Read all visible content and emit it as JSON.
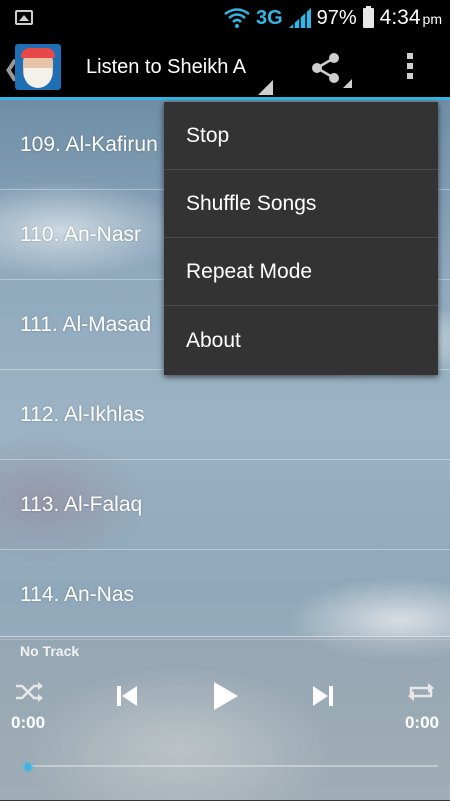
{
  "status_bar": {
    "network_type": "3G",
    "battery_percent": "97%",
    "time": "4:34",
    "time_suffix": "pm"
  },
  "action_bar": {
    "title": "Listen to Sheikh A",
    "share_icon": "share-icon",
    "overflow_icon": "overflow-menu-icon"
  },
  "tracks": [
    {
      "label": "109. Al-Kafirun"
    },
    {
      "label": "110. An-Nasr"
    },
    {
      "label": "111. Al-Masad"
    },
    {
      "label": "112. Al-Ikhlas"
    },
    {
      "label": "113. Al-Falaq"
    },
    {
      "label": "114. An-Nas"
    }
  ],
  "overflow_menu": {
    "items": [
      {
        "label": "Stop"
      },
      {
        "label": "Shuffle Songs"
      },
      {
        "label": "Repeat Mode"
      },
      {
        "label": "About"
      }
    ]
  },
  "player": {
    "now_playing": "No Track",
    "elapsed": "0:00",
    "duration": "0:00",
    "progress": 0
  },
  "colors": {
    "accent": "#33b5e5",
    "menu_background": "#333333",
    "action_bar": "#000000"
  }
}
